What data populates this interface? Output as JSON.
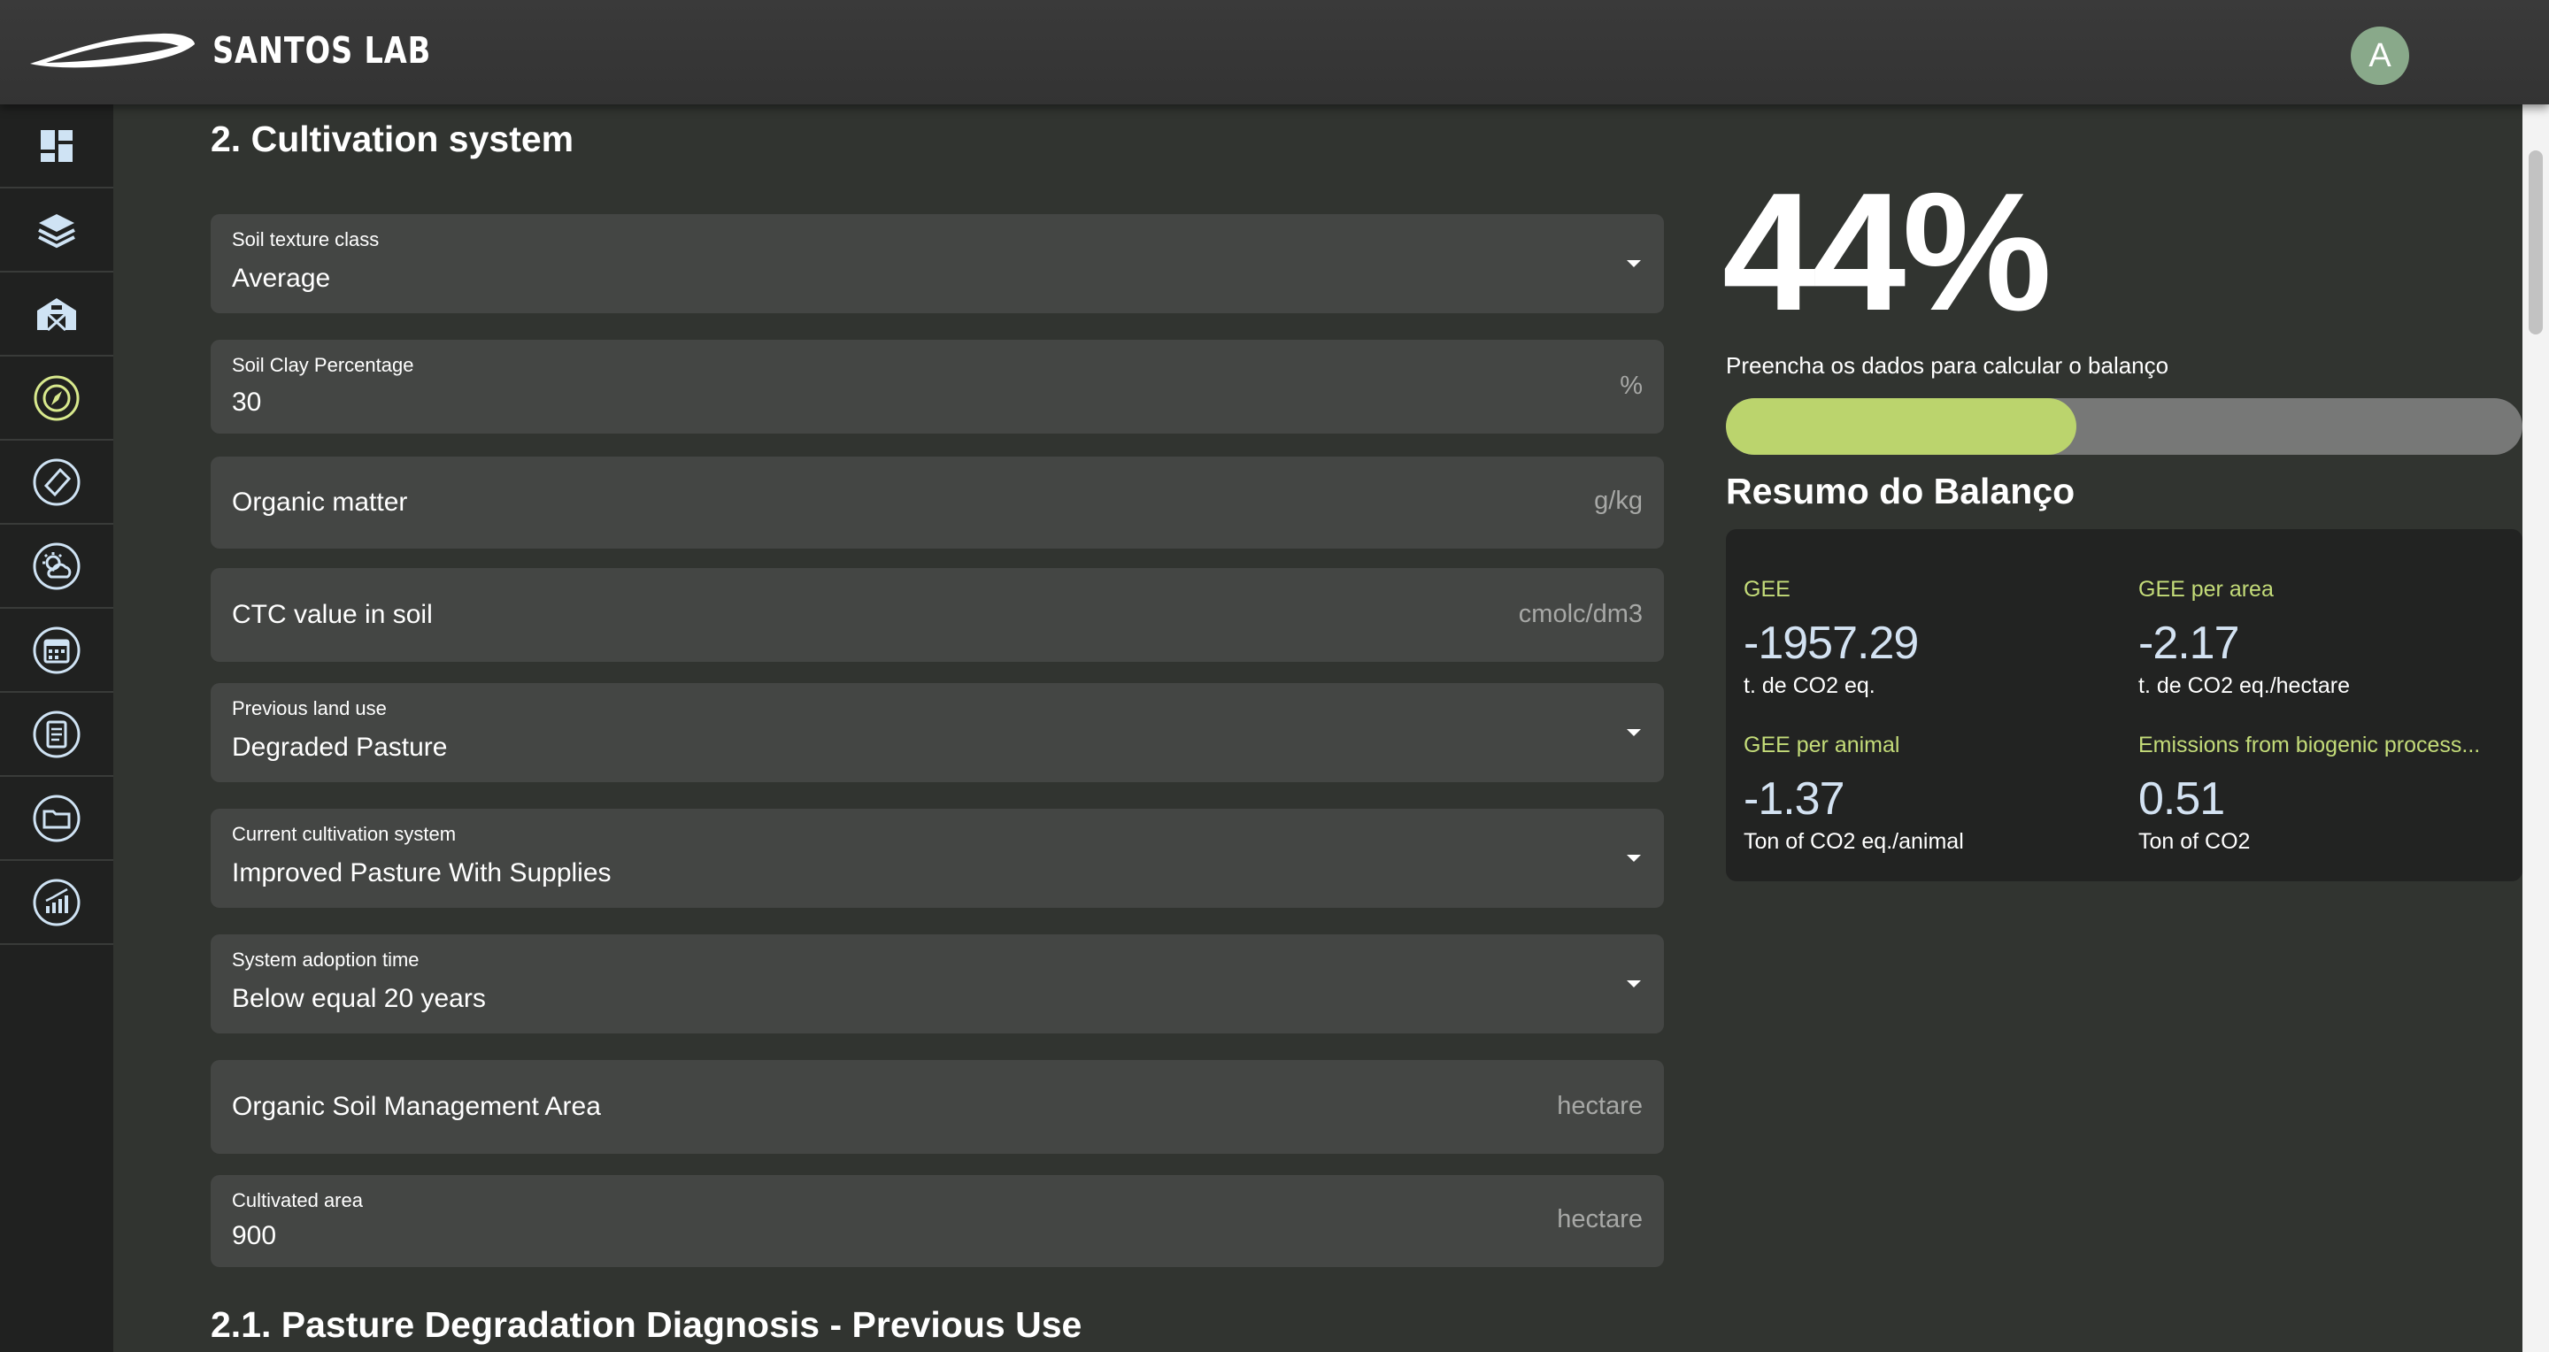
{
  "header": {
    "logo_text": "SANTOS LAB",
    "avatar_letter": "A"
  },
  "sidebar": {
    "items": [
      {
        "icon": "dashboard-icon"
      },
      {
        "icon": "layers-icon"
      },
      {
        "icon": "farm-icon"
      },
      {
        "icon": "compass-icon"
      },
      {
        "icon": "tag-icon"
      },
      {
        "icon": "weather-icon"
      },
      {
        "icon": "calendar-icon"
      },
      {
        "icon": "document-icon"
      },
      {
        "icon": "folder-icon"
      },
      {
        "icon": "chart-icon"
      }
    ]
  },
  "main": {
    "section_title": "2. Cultivation system",
    "fields": {
      "soil_texture": {
        "label": "Soil texture class",
        "value": "Average"
      },
      "soil_clay": {
        "label": "Soil Clay Percentage",
        "value": "30",
        "unit": "%"
      },
      "organic_matter": {
        "placeholder": "Organic matter",
        "unit": "g/kg"
      },
      "ctc": {
        "placeholder": "CTC value in soil",
        "unit": "cmolc/dm3"
      },
      "previous_land_use": {
        "label": "Previous land use",
        "value": "Degraded Pasture"
      },
      "current_cultivation": {
        "label": "Current cultivation system",
        "value": "Improved Pasture With Supplies"
      },
      "adoption_time": {
        "label": "System adoption time",
        "value": "Below equal 20 years"
      },
      "organic_soil_area": {
        "placeholder": "Organic Soil Management Area",
        "unit": "hectare"
      },
      "cultivated_area": {
        "label": "Cultivated area",
        "value": "900",
        "unit": "hectare"
      }
    },
    "next_section_title": "2.1. Pasture Degradation Diagnosis - Previous Use"
  },
  "summary": {
    "percent_text": "44%",
    "progress": 0.44,
    "hint": "Preencha os dados para calcular o balanço",
    "title": "Resumo do Balanço",
    "metrics": {
      "gee": {
        "label": "GEE",
        "value": "-1957.29",
        "unit": "t. de CO2 eq."
      },
      "gee_area": {
        "label": "GEE per area",
        "value": "-2.17",
        "unit": "t. de CO2 eq./hectare"
      },
      "gee_animal": {
        "label": "GEE per animal",
        "value": "-1.37",
        "unit": "Ton of CO2 eq./animal"
      },
      "biogenic": {
        "label": "Emissions from biogenic process...",
        "value": "0.51",
        "unit": "Ton of CO2"
      }
    }
  },
  "colors": {
    "accent": "#bbd46d",
    "metric_value": "#d3e2f2",
    "sidebar_icon": "#cfe3f4",
    "sidebar_icon_active": "#d8e98d"
  }
}
